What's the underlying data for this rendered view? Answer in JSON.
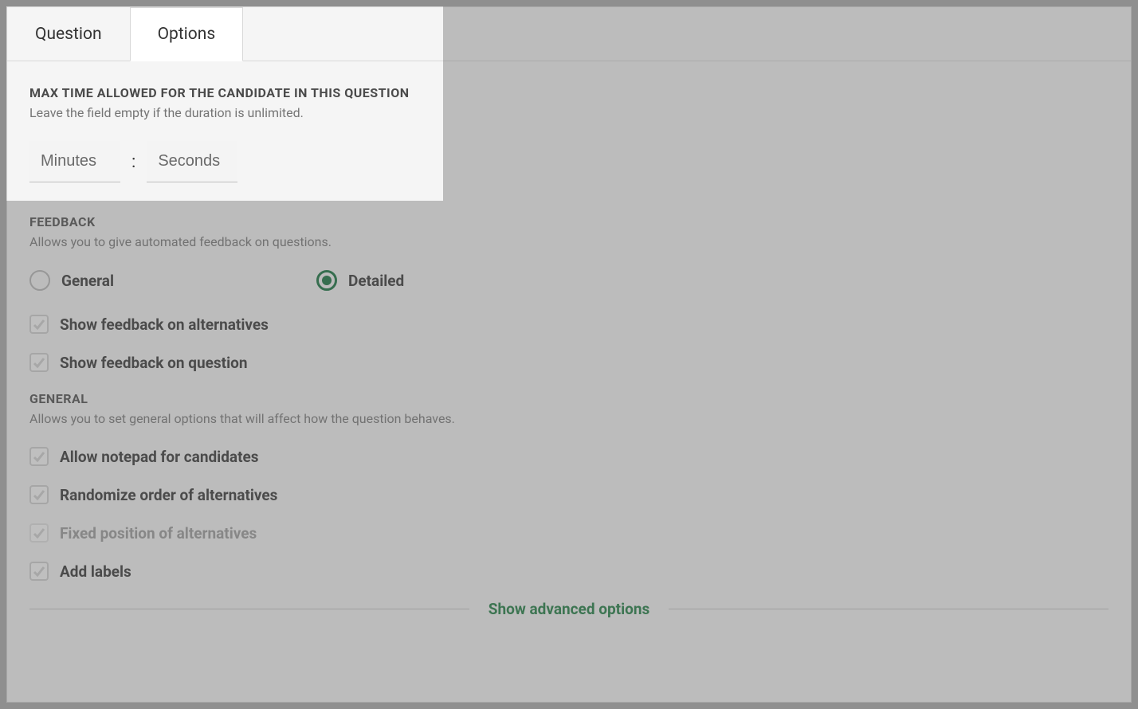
{
  "tabs": {
    "question": "Question",
    "options": "Options"
  },
  "maxTime": {
    "heading": "MAX TIME ALLOWED FOR THE CANDIDATE IN THIS QUESTION",
    "desc": "Leave the field empty if the duration is unlimited.",
    "minutes_placeholder": "Minutes",
    "seconds_placeholder": "Seconds",
    "separator": ":"
  },
  "feedback": {
    "heading": "FEEDBACK",
    "desc": "Allows you to give automated feedback on questions.",
    "general_label": "General",
    "detailed_label": "Detailed",
    "show_alt_label": "Show feedback on alternatives",
    "show_q_label": "Show feedback on question"
  },
  "general": {
    "heading": "GENERAL",
    "desc": "Allows you to set general options that will affect how the question behaves.",
    "notepad_label": "Allow notepad for candidates",
    "randomize_label": "Randomize order of alternatives",
    "fixed_label": "Fixed position of alternatives",
    "labels_label": "Add labels"
  },
  "advanced_link": "Show advanced options"
}
